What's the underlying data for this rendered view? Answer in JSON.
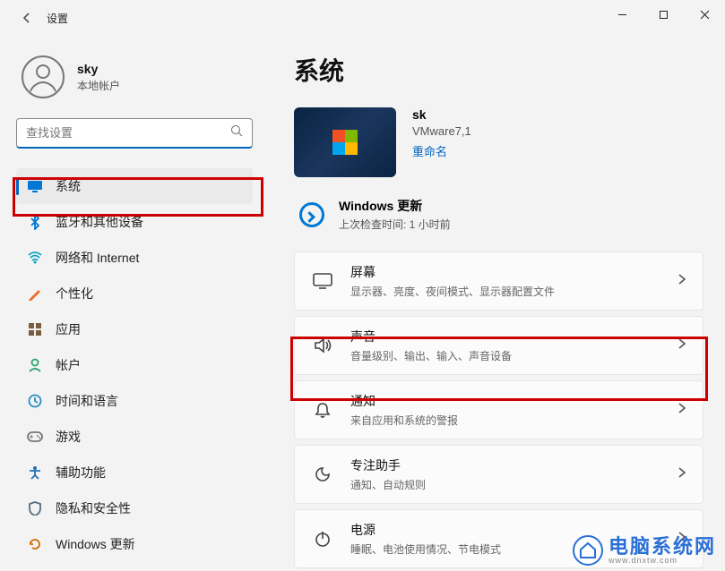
{
  "window": {
    "title": "设置"
  },
  "user": {
    "name": "sky",
    "sub": "本地帐户"
  },
  "search": {
    "placeholder": "查找设置"
  },
  "nav": [
    {
      "key": "system",
      "label": "系统",
      "active": true
    },
    {
      "key": "bluetooth",
      "label": "蓝牙和其他设备",
      "active": false
    },
    {
      "key": "network",
      "label": "网络和 Internet",
      "active": false
    },
    {
      "key": "personal",
      "label": "个性化",
      "active": false
    },
    {
      "key": "apps",
      "label": "应用",
      "active": false
    },
    {
      "key": "accounts",
      "label": "帐户",
      "active": false
    },
    {
      "key": "time",
      "label": "时间和语言",
      "active": false
    },
    {
      "key": "gaming",
      "label": "游戏",
      "active": false
    },
    {
      "key": "access",
      "label": "辅助功能",
      "active": false
    },
    {
      "key": "privacy",
      "label": "隐私和安全性",
      "active": false
    },
    {
      "key": "update",
      "label": "Windows 更新",
      "active": false
    }
  ],
  "page": {
    "heading": "系统",
    "device": {
      "name": "sk",
      "model": "VMware7,1",
      "rename": "重命名"
    },
    "update": {
      "title": "Windows 更新",
      "sub": "上次检查时间: 1 小时前"
    },
    "cards": [
      {
        "key": "display",
        "title": "屏幕",
        "sub": "显示器、亮度、夜间模式、显示器配置文件"
      },
      {
        "key": "sound",
        "title": "声音",
        "sub": "音量级别、输出、输入、声音设备"
      },
      {
        "key": "notify",
        "title": "通知",
        "sub": "来自应用和系统的警报"
      },
      {
        "key": "focus",
        "title": "专注助手",
        "sub": "通知、自动规则"
      },
      {
        "key": "power",
        "title": "电源",
        "sub": "睡眠、电池使用情况、节电模式"
      }
    ]
  },
  "watermark": {
    "text": "电脑系统网",
    "url": "www.dnxtw.com"
  },
  "icon_colors": {
    "system": "#0078d4",
    "bluetooth": "#0078d4",
    "network": "#0aa3c2",
    "personal": "#e86e2f",
    "apps": "#7a5c3e",
    "accounts": "#2aa36f",
    "time": "#2a8cc4",
    "gaming": "#777",
    "access": "#1f6fb0",
    "privacy": "#5a6b78",
    "update": "#d66a00"
  }
}
